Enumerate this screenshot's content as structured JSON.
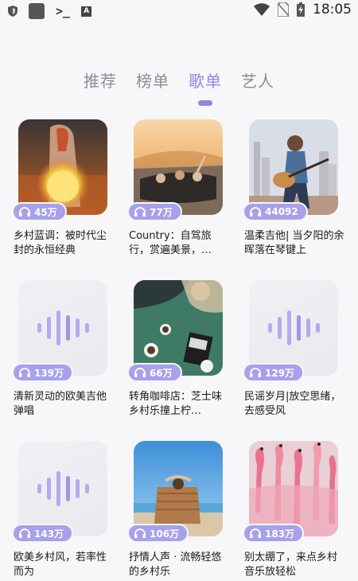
{
  "status_bar": {
    "time": "18:05",
    "a_label": "A",
    "term_label": ">_"
  },
  "tabs": [
    {
      "label": "推荐",
      "active": false
    },
    {
      "label": "榜单",
      "active": false
    },
    {
      "label": "歌单",
      "active": true
    },
    {
      "label": "艺人",
      "active": false
    }
  ],
  "colors": {
    "accent": "#8f86e4",
    "badge": "#a7a0ea"
  },
  "playlists": [
    {
      "plays": "45万",
      "title": "乡村蓝调：被时代尘封的永恒经典",
      "cover": "lantern-woman"
    },
    {
      "plays": "77万",
      "title": "Country：自驾旅行，赏遍美景，…",
      "cover": "convertible-road-trip"
    },
    {
      "plays": "44092",
      "title": "温柔吉他| 当夕阳的余晖落在琴键上",
      "cover": "guitar-girl-city"
    },
    {
      "plays": "139万",
      "title": "清新灵动的欧美吉他弹唱",
      "cover": "sound-wave-placeholder"
    },
    {
      "plays": "66万",
      "title": "转角咖啡店：芝士味乡村乐撞上柠…",
      "cover": "coffee-table"
    },
    {
      "plays": "129万",
      "title": "民谣岁月|放空思绪，去感受风",
      "cover": "sound-wave-placeholder"
    },
    {
      "plays": "143万",
      "title": "欧美乡村风，若率性而为",
      "cover": "sound-wave-placeholder"
    },
    {
      "plays": "106万",
      "title": "抒情人声 · 流畅轻悠的乡村乐",
      "cover": "beach-chair-reader"
    },
    {
      "plays": "183万",
      "title": "别太绷了，来点乡村音乐放轻松",
      "cover": "flamingos"
    }
  ]
}
